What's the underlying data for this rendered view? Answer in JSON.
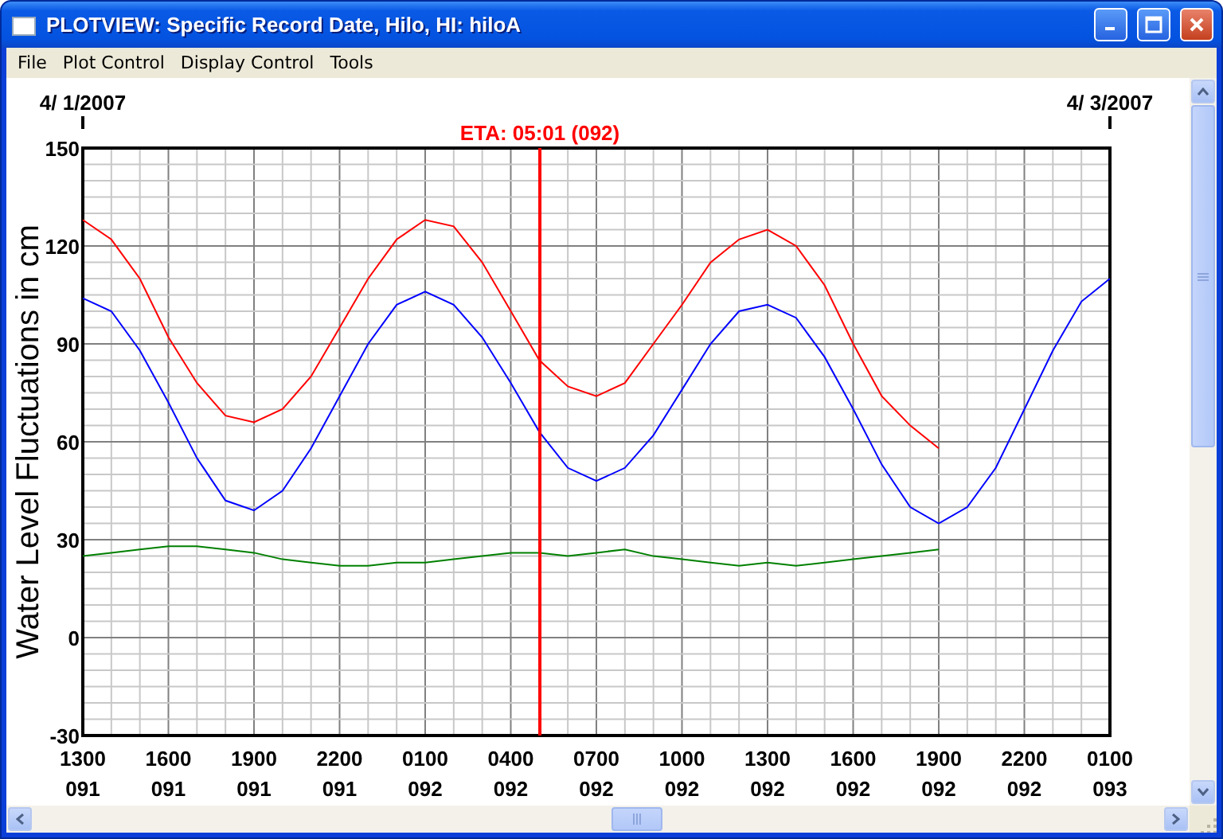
{
  "window": {
    "title": "PLOTVIEW: Specific Record Date, Hilo, HI: hiloA"
  },
  "menu": [
    "File",
    "Plot Control",
    "Display Control",
    "Tools"
  ],
  "plot": {
    "start_date": "4/ 1/2007",
    "end_date": "4/ 3/2007",
    "chart_data": {
      "type": "line",
      "ylabel": "Water Level Fluctuations in cm",
      "categories": [
        "1300 091",
        null,
        null,
        "1600 091",
        null,
        null,
        "1900 091",
        null,
        null,
        "2200 091",
        null,
        null,
        "0100 092",
        null,
        null,
        "0400 092",
        null,
        null,
        "0700 092",
        null,
        null,
        "1000 092",
        null,
        null,
        "1300 092",
        null,
        null,
        "1600 092",
        null,
        null,
        "1900 092",
        null,
        null,
        "2200 092",
        null,
        null,
        "0100 093"
      ],
      "ylim": [
        -30,
        150
      ],
      "yticks": [
        -30,
        0,
        30,
        60,
        90,
        120,
        150
      ],
      "series": [
        {
          "color": "#ff0000",
          "values": [
            128,
            122,
            110,
            92,
            78,
            68,
            66,
            70,
            80,
            95,
            110,
            122,
            128,
            126,
            115,
            100,
            85,
            77,
            74,
            78,
            90,
            102,
            115,
            122,
            125,
            120,
            108,
            90,
            74,
            65,
            58,
            null,
            null,
            null,
            null,
            null,
            null
          ]
        },
        {
          "color": "#0000ff",
          "values": [
            104,
            100,
            88,
            72,
            55,
            42,
            39,
            45,
            58,
            74,
            90,
            102,
            106,
            102,
            92,
            78,
            63,
            52,
            48,
            52,
            62,
            76,
            90,
            100,
            102,
            98,
            86,
            70,
            53,
            40,
            35,
            40,
            52,
            70,
            88,
            103,
            110
          ]
        },
        {
          "color": "#008000",
          "values": [
            25,
            26,
            27,
            28,
            28,
            27,
            26,
            24,
            23,
            22,
            22,
            23,
            23,
            24,
            25,
            26,
            26,
            25,
            26,
            27,
            25,
            24,
            23,
            22,
            23,
            22,
            23,
            24,
            25,
            26,
            27,
            null,
            null,
            null,
            null,
            null,
            null
          ]
        }
      ],
      "grid": true
    },
    "eta_label": "ETA: 05:01 (092)"
  }
}
